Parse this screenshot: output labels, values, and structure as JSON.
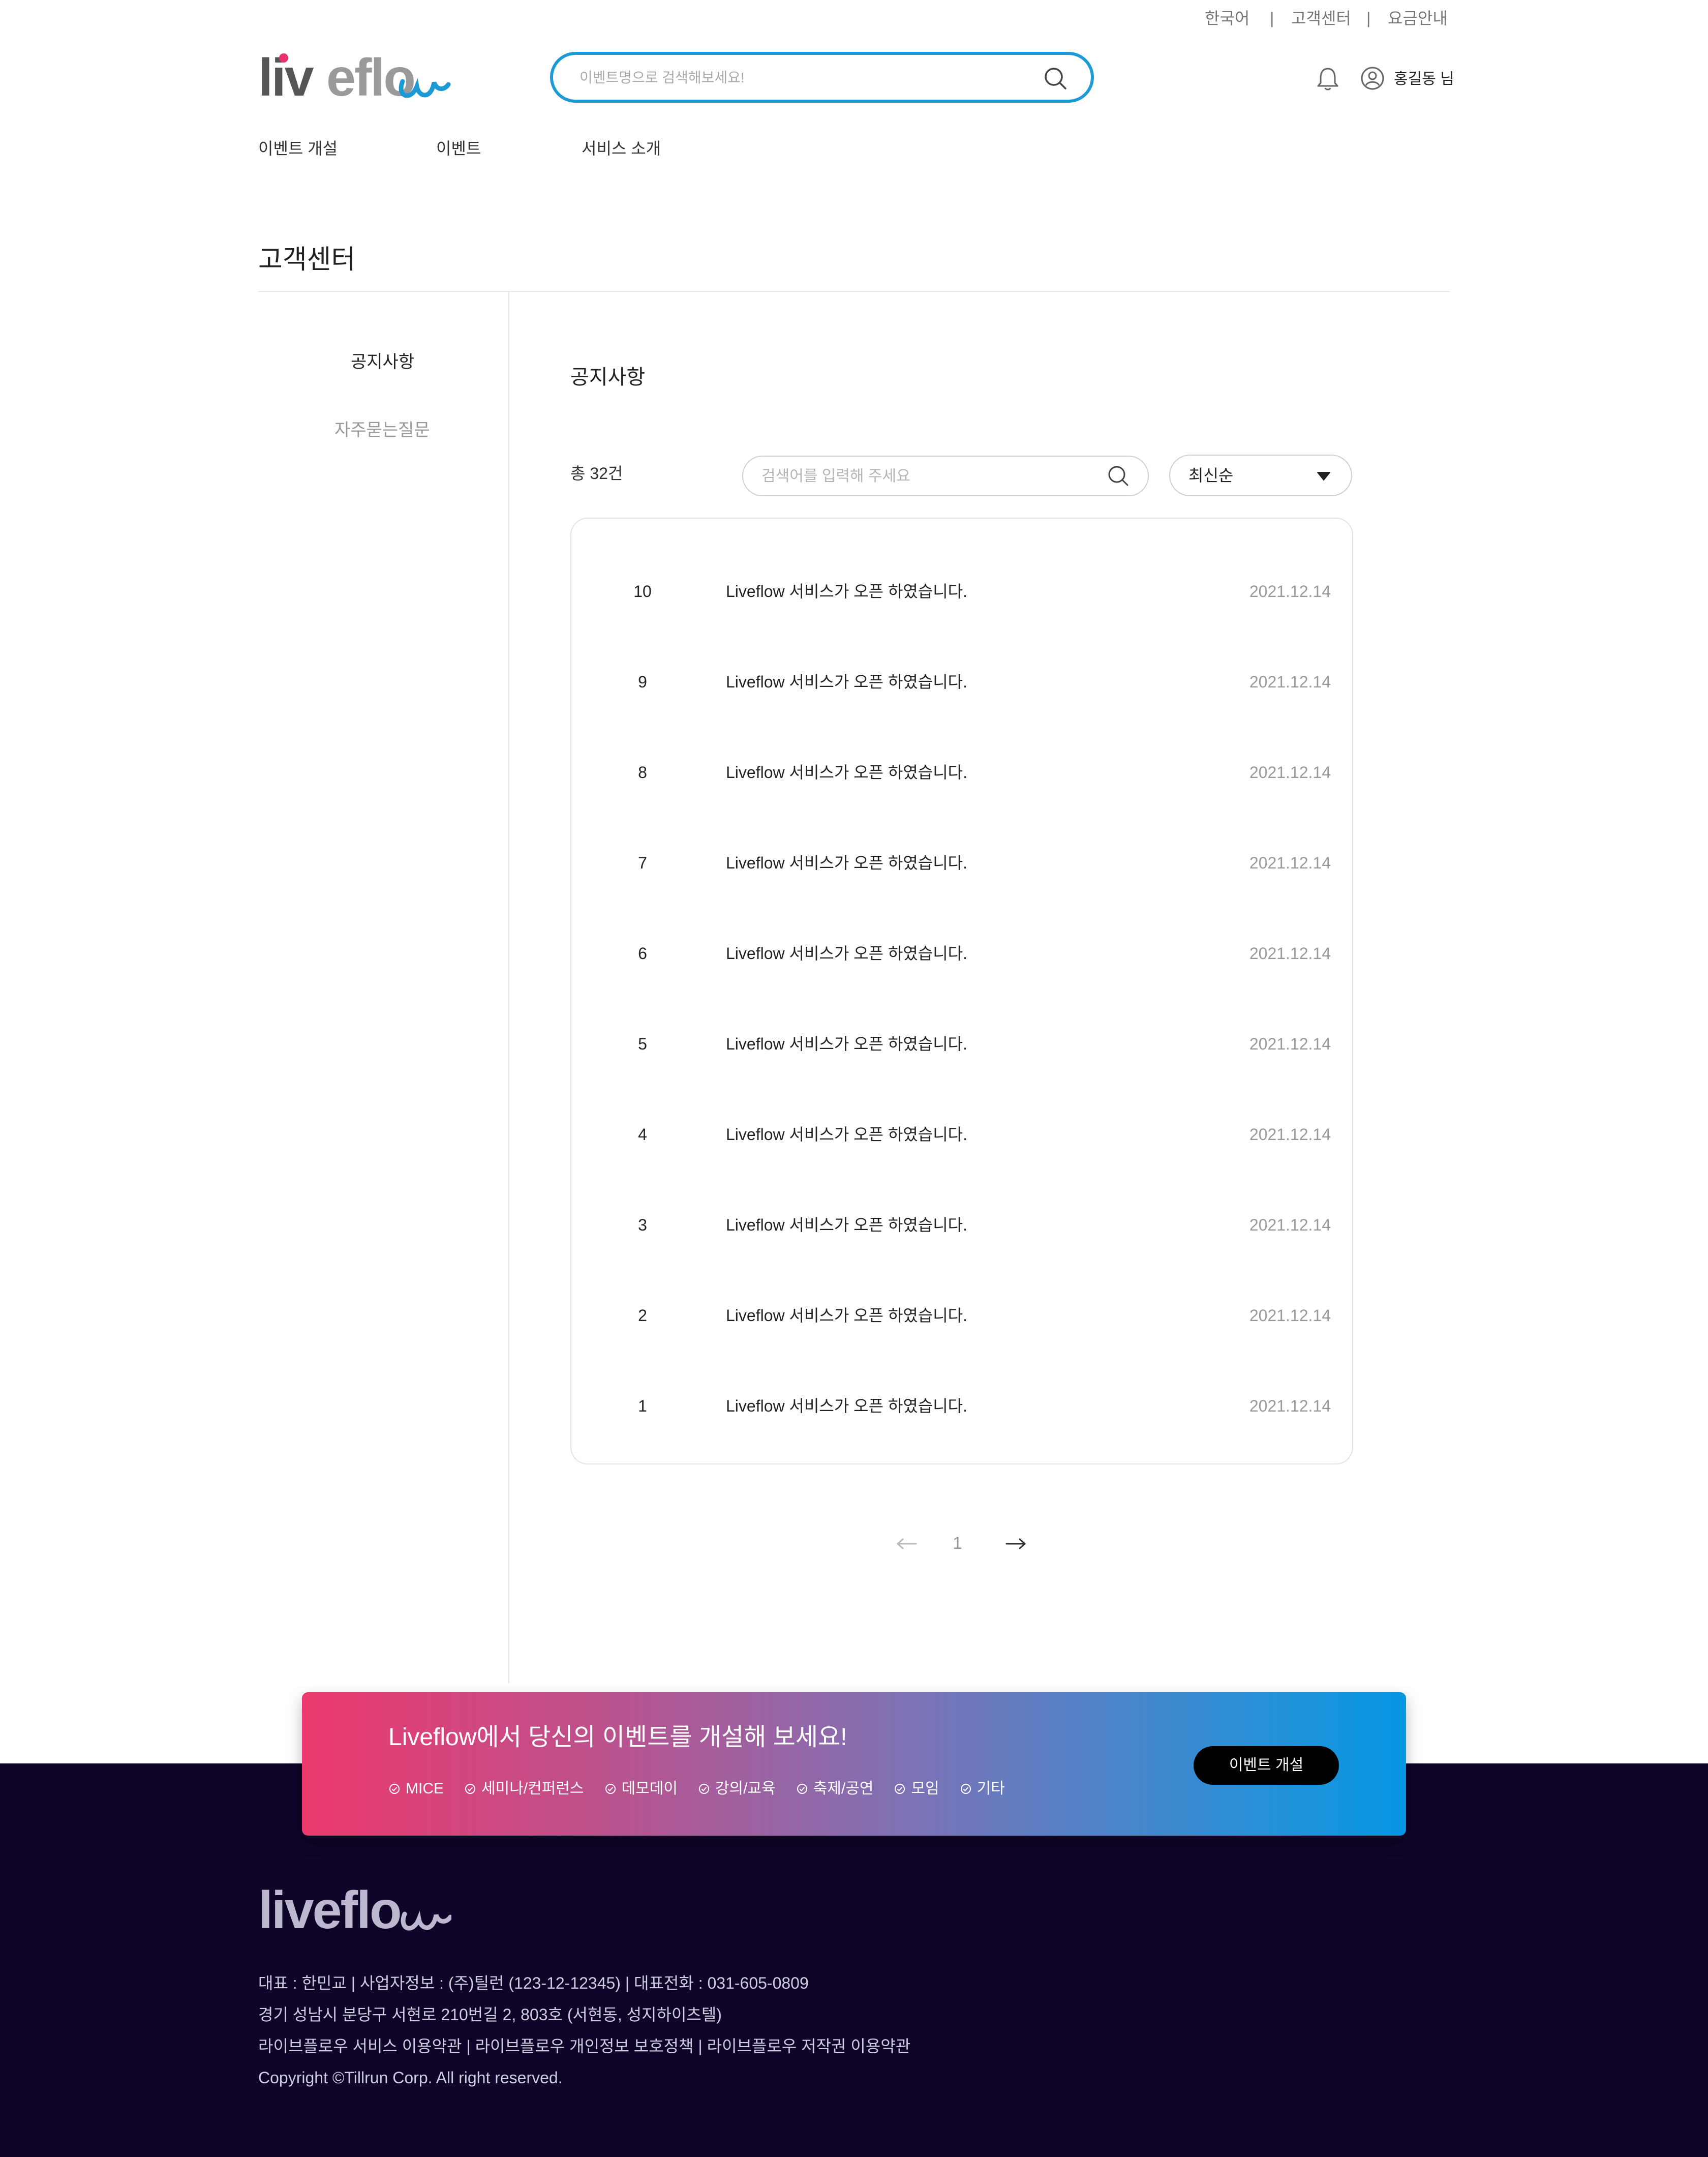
{
  "top_links": {
    "language": "한국어",
    "support": "고객센터",
    "pricing": "요금안내",
    "separator": "|"
  },
  "header": {
    "logo": "liveflow",
    "search_placeholder": "이벤트명으로 검색해보세요!",
    "user_name": "홍길동 님",
    "icons": {
      "search": "search-icon",
      "bell": "bell-icon",
      "user": "user-circle-icon"
    }
  },
  "nav": [
    {
      "label": "이벤트 개설"
    },
    {
      "label": "이벤트"
    },
    {
      "label": "서비스 소개"
    }
  ],
  "page": {
    "title": "고객센터"
  },
  "sidebar": {
    "items": [
      {
        "label": "공지사항",
        "active": true
      },
      {
        "label": "자주묻는질문",
        "active": false
      }
    ]
  },
  "notice": {
    "title": "공지사항",
    "total": "총 32건",
    "search_placeholder": "검색어를 입력해 주세요",
    "sort": {
      "selected": "최신순"
    },
    "rows": [
      {
        "num": "10",
        "title": "Liveflow 서비스가 오픈 하였습니다.",
        "date": "2021.12.14"
      },
      {
        "num": "9",
        "title": "Liveflow 서비스가 오픈 하였습니다.",
        "date": "2021.12.14"
      },
      {
        "num": "8",
        "title": "Liveflow 서비스가 오픈 하였습니다.",
        "date": "2021.12.14"
      },
      {
        "num": "7",
        "title": "Liveflow 서비스가 오픈 하였습니다.",
        "date": "2021.12.14"
      },
      {
        "num": "6",
        "title": "Liveflow 서비스가 오픈 하였습니다.",
        "date": "2021.12.14"
      },
      {
        "num": "5",
        "title": "Liveflow 서비스가 오픈 하였습니다.",
        "date": "2021.12.14"
      },
      {
        "num": "4",
        "title": "Liveflow 서비스가 오픈 하였습니다.",
        "date": "2021.12.14"
      },
      {
        "num": "3",
        "title": "Liveflow 서비스가 오픈 하였습니다.",
        "date": "2021.12.14"
      },
      {
        "num": "2",
        "title": "Liveflow 서비스가 오픈 하였습니다.",
        "date": "2021.12.14"
      },
      {
        "num": "1",
        "title": "Liveflow 서비스가 오픈 하였습니다.",
        "date": "2021.12.14"
      }
    ],
    "pagination": {
      "current_page": "1"
    }
  },
  "banner": {
    "title": "Liveflow에서 당신의 이벤트를 개설해 보세요!",
    "tags": [
      "MICE",
      "세미나/컨퍼런스",
      "데모데이",
      "강의/교육",
      "축제/공연",
      "모임",
      "기타"
    ],
    "button": "이벤트 개설",
    "gradient_start": "#ec3a6e",
    "gradient_end": "#0597e3"
  },
  "footer": {
    "logo": "liveflow",
    "line1": "대표 : 한민교 | 사업자정보 : (주)틸런 (123-12-12345) | 대표전화 : 031-605-0809",
    "line2": "경기 성남시 분당구 서현로 210번길 2, 803호 (서현동, 성지하이츠텔)",
    "line3": "라이브플로우 서비스 이용약관 | 라이브플로우 개인정보 보호정책 | 라이브플로우 저작권 이용약관",
    "line4": "Copyright ©Tillrun Corp. All right reserved."
  },
  "colors": {
    "accent": "#1c9ad6",
    "logo_gray": "#555555",
    "logo_accent": "#1c9ad6",
    "logo_dot": "#e8336c",
    "footer_bg": "#0f0529"
  }
}
